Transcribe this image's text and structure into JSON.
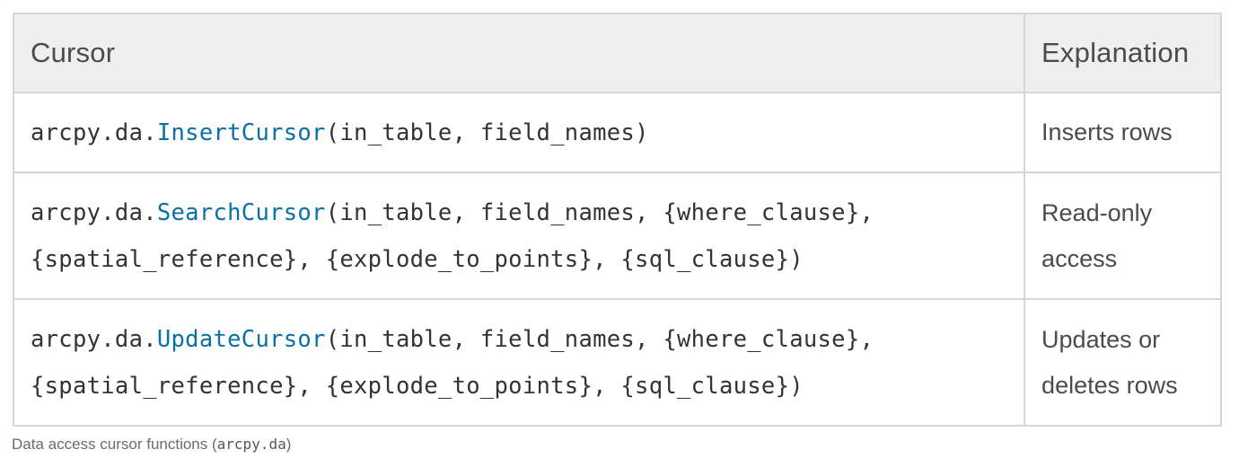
{
  "table": {
    "headers": {
      "cursor": "Cursor",
      "explanation": "Explanation"
    },
    "rows": [
      {
        "prefix": "arcpy.da.",
        "function": "InsertCursor",
        "args_line1": "(in_table, field_names)",
        "args_line2": "",
        "explanation": "Inserts rows"
      },
      {
        "prefix": "arcpy.da.",
        "function": "SearchCursor",
        "args_line1": "(in_table, field_names, {where_clause},",
        "args_line2": "{spatial_reference}, {explode_to_points}, {sql_clause})",
        "explanation": "Read-only access"
      },
      {
        "prefix": "arcpy.da.",
        "function": "UpdateCursor",
        "args_line1": "(in_table, field_names, {where_clause},",
        "args_line2": "{spatial_reference}, {explode_to_points}, {sql_clause})",
        "explanation": "Updates or deletes rows"
      }
    ]
  },
  "caption": {
    "text": "Data access cursor functions (",
    "code": "arcpy.da",
    "close": ")"
  },
  "colors": {
    "function_link": "#0b6fa8",
    "header_bg": "#efefef",
    "border": "#d6d6d6"
  }
}
